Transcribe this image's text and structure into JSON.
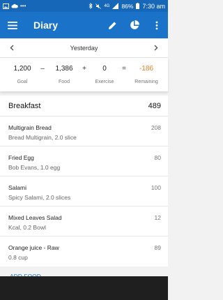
{
  "status_bar": {
    "battery": "86%",
    "time": "7:30 am",
    "signal": "4G"
  },
  "app_bar": {
    "title": "Diary",
    "icons": [
      "menu-icon",
      "edit-icon",
      "pie-chart-icon",
      "more-vert-icon"
    ]
  },
  "date_nav": {
    "date": "Yesterday"
  },
  "summary": {
    "goal_value": "1,200",
    "goal_label": "Goal",
    "minus": "–",
    "food_value": "1,386",
    "food_label": "Food",
    "plus": "+",
    "exercise_value": "0",
    "exercise_label": "Exercise",
    "equals": "=",
    "remaining_value": "-186",
    "remaining_label": "Remaining",
    "remaining_color": "#e67e22"
  },
  "meal": {
    "name": "Breakfast",
    "calories": "489",
    "entries": [
      {
        "name": "Multigrain Bread",
        "desc": "Bread Multigrain, 2.0 slice",
        "calories": "208"
      },
      {
        "name": "Fried Egg",
        "desc": "Bob Evans, 1.0 egg",
        "calories": "80"
      },
      {
        "name": "Salami",
        "desc": "Spicy Salami, 2.0 slices",
        "calories": "100"
      },
      {
        "name": "Mixed Leaves Salad",
        "desc": "Kcal, 0.2 Bowl",
        "calories": "12"
      },
      {
        "name": "Orange juice - Raw",
        "desc": "0.8 cup",
        "calories": "89"
      }
    ]
  },
  "add_food": {
    "label": "ADD FOOD"
  },
  "colors": {
    "primary": "#1a73c8",
    "status": "#1767b8"
  }
}
